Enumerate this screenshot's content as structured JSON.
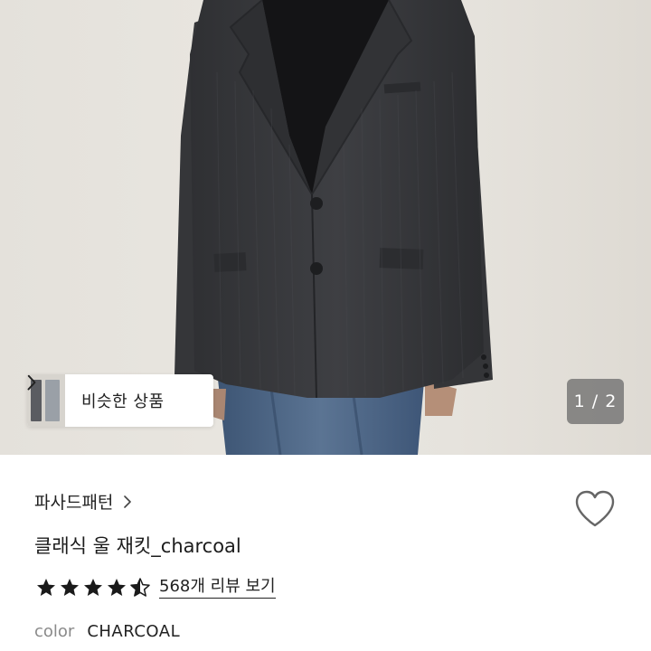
{
  "similar_products": {
    "label": "비슷한 상품"
  },
  "gallery": {
    "page_indicator": "1 / 2"
  },
  "product": {
    "brand": "파사드패턴",
    "title": "클래식 울 재킷_charcoal",
    "rating": 4.5,
    "review_link": "568개 리뷰 보기",
    "color_label": "color",
    "color_value": "CHARCOAL"
  },
  "colors": {
    "jacket": "#3b3c3f",
    "background": "#e7e4de",
    "star": "#1a1a1a",
    "indicator_bg": "#6e6e6e"
  },
  "icons": [
    "chevron-right-icon",
    "heart-icon",
    "star-icon"
  ]
}
